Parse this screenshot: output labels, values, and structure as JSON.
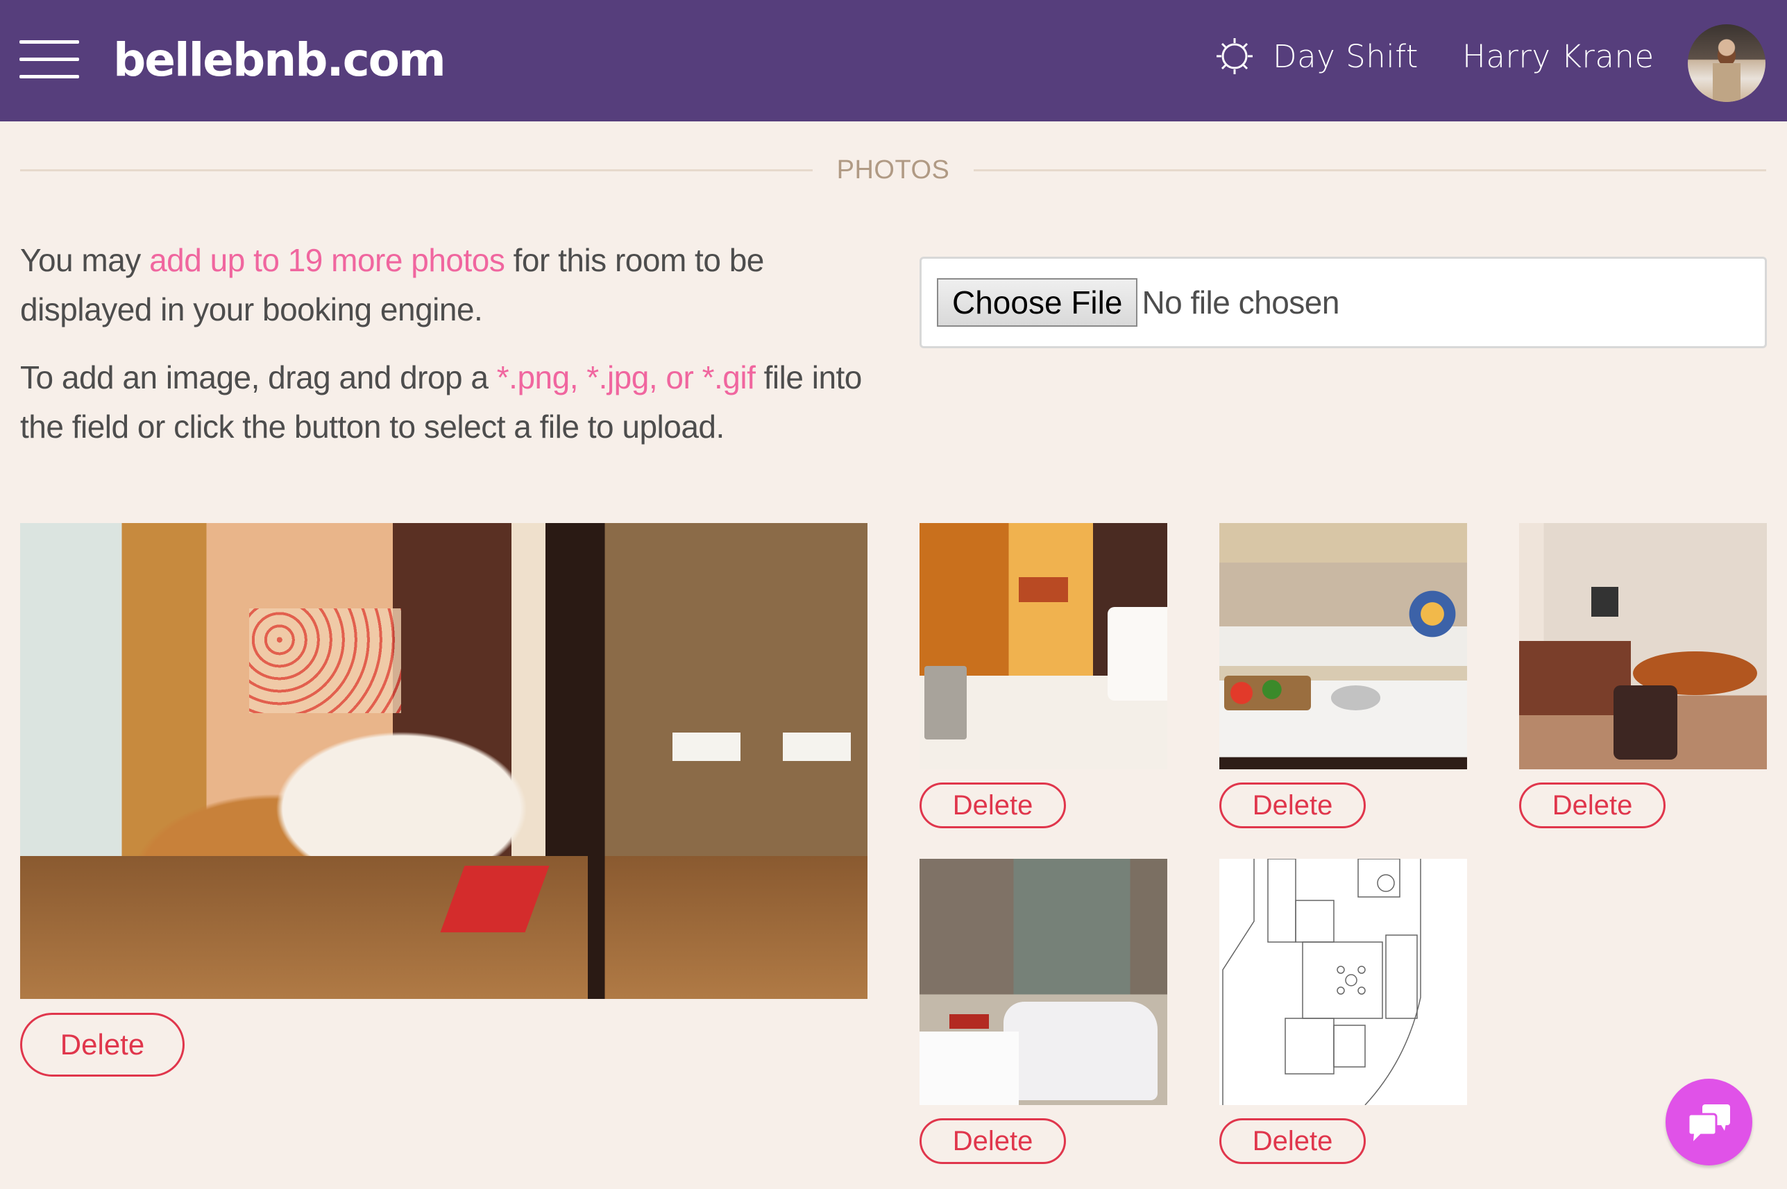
{
  "header": {
    "brand": "bellebnb.com",
    "menu_icon": "hamburger-menu-icon",
    "shift_icon": "sun-icon",
    "shift_label": "Day Shift",
    "user_name": "Harry Krane",
    "avatar_icon": "user-avatar",
    "background_color": "#563e7c"
  },
  "section": {
    "title": "PHOTOS"
  },
  "intro": {
    "line1_prefix": "You may ",
    "line1_link": "add up to 19 more photos",
    "line1_suffix": " for this room to be displayed in your booking engine.",
    "line2_prefix": "To add an image, drag and drop a ",
    "line2_highlight": "*.png, *.jpg, or *.gif",
    "line2_suffix": " file into the field or click the button to select a file to upload.",
    "accent_color": "#f0669f"
  },
  "upload": {
    "button_label": "Choose File",
    "status_text": "No file chosen"
  },
  "photos": {
    "main": {
      "subject": "bedroom-with-ensuite",
      "delete_label": "Delete"
    },
    "thumbnails": [
      {
        "subject": "bedside-champagne",
        "delete_label": "Delete"
      },
      {
        "subject": "kitchen",
        "delete_label": "Delete"
      },
      {
        "subject": "living-dining-room",
        "delete_label": "Delete"
      },
      {
        "subject": "bathroom-jacuzzi",
        "delete_label": "Delete"
      },
      {
        "subject": "floor-plan",
        "delete_label": "Delete"
      }
    ],
    "delete_color": "#e0364c"
  },
  "chat": {
    "icon": "chat-bubbles-icon",
    "color": "#e052e8"
  }
}
